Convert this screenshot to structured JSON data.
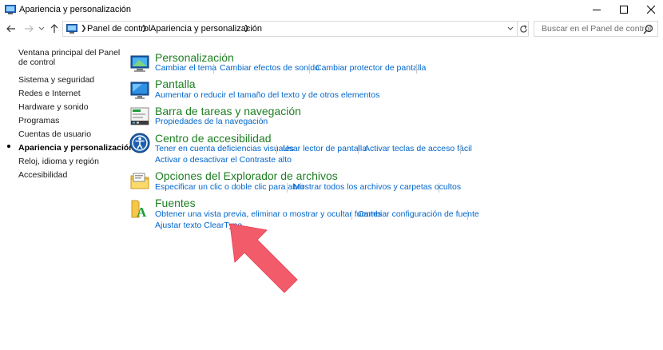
{
  "window": {
    "title": "Apariencia y personalización"
  },
  "nav": {
    "breadcrumb": [
      "Panel de control",
      "Apariencia y personalización"
    ],
    "search_placeholder": "Buscar en el Panel de control"
  },
  "sidebar": {
    "items": [
      {
        "label": "Ventana principal del Panel de control",
        "active": false
      },
      {
        "label": "Sistema y seguridad",
        "active": false
      },
      {
        "label": "Redes e Internet",
        "active": false
      },
      {
        "label": "Hardware y sonido",
        "active": false
      },
      {
        "label": "Programas",
        "active": false
      },
      {
        "label": "Cuentas de usuario",
        "active": false
      },
      {
        "label": "Apariencia y personalización",
        "active": true
      },
      {
        "label": "Reloj, idioma y región",
        "active": false
      },
      {
        "label": "Accesibilidad",
        "active": false
      }
    ]
  },
  "categories": [
    {
      "title": "Personalización",
      "icon": "personalization-icon",
      "links": [
        "Cambiar el tema",
        "Cambiar efectos de sonido",
        "Cambiar protector de pantalla"
      ]
    },
    {
      "title": "Pantalla",
      "icon": "display-icon",
      "links": [
        "Aumentar o reducir el tamaño del texto y de otros elementos"
      ]
    },
    {
      "title": "Barra de tareas y navegación",
      "icon": "taskbar-icon",
      "links": [
        "Propiedades de la navegación"
      ]
    },
    {
      "title": "Centro de accesibilidad",
      "icon": "accessibility-icon",
      "links": [
        "Tener en cuenta deficiencias visuales",
        "Usar lector de pantalla",
        "Activar teclas de acceso fácil",
        "Activar o desactivar el Contraste alto"
      ]
    },
    {
      "title": "Opciones del Explorador de archivos",
      "icon": "folder-options-icon",
      "links": [
        "Especificar un clic o doble clic para abrir",
        "Mostrar todos los archivos y carpetas ocultos"
      ]
    },
    {
      "title": "Fuentes",
      "icon": "fonts-icon",
      "links": [
        "Obtener una vista previa, eliminar o mostrar y ocultar fuentes",
        "Cambiar configuración de fuente",
        "Ajustar texto ClearType"
      ]
    }
  ],
  "colors": {
    "category_title": "#1e7f22",
    "link": "#0066cc",
    "annotation_arrow": "#f25c6a"
  }
}
